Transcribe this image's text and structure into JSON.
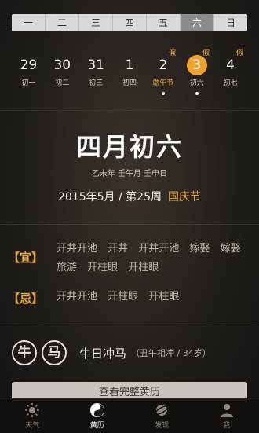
{
  "weekdays": [
    "一",
    "二",
    "三",
    "四",
    "五",
    "六",
    "日"
  ],
  "dates": [
    {
      "num": "29",
      "lunar": "初一",
      "hol": "",
      "dot": false,
      "selected": false,
      "festival": false
    },
    {
      "num": "30",
      "lunar": "初二",
      "hol": "",
      "dot": false,
      "selected": false,
      "festival": false
    },
    {
      "num": "31",
      "lunar": "初三",
      "hol": "",
      "dot": false,
      "selected": false,
      "festival": false
    },
    {
      "num": "1",
      "lunar": "初四",
      "hol": "",
      "dot": false,
      "selected": false,
      "festival": false
    },
    {
      "num": "2",
      "lunar": "端午节",
      "hol": "假",
      "dot": true,
      "selected": false,
      "festival": true
    },
    {
      "num": "3",
      "lunar": "初六",
      "hol": "假",
      "dot": true,
      "selected": true,
      "festival": false
    },
    {
      "num": "4",
      "lunar": "初七",
      "hol": "假",
      "dot": false,
      "selected": false,
      "festival": false
    }
  ],
  "main": {
    "lunar_date": "四月初六",
    "ganzhi": "乙未年  壬午月  壬申日",
    "solar": "2015年5月 / 第25周",
    "holiday": "国庆节"
  },
  "yi": {
    "tag": "【宜】",
    "items": [
      "开井开池",
      "开井",
      "开井开池",
      "嫁娶",
      "嫁娶",
      "旅游",
      "开柱眼",
      "开柱眼"
    ]
  },
  "ji": {
    "tag": "【忌】",
    "items": [
      "开井开池",
      "开柱眼",
      "开柱眼"
    ]
  },
  "zodiac": {
    "animal1": "牛",
    "animal2": "马",
    "text": "牛日冲马",
    "sub": "（丑午相冲 / 34岁）"
  },
  "full_button": "查看完整黄历",
  "tabs": [
    {
      "label": "天气",
      "icon": "weather-icon"
    },
    {
      "label": "黄历",
      "icon": "yinyang-icon"
    },
    {
      "label": "发现",
      "icon": "planet-icon"
    },
    {
      "label": "我",
      "icon": "user-icon"
    }
  ],
  "colors": {
    "accent": "#f0a22b",
    "festival": "#e8a93a"
  }
}
